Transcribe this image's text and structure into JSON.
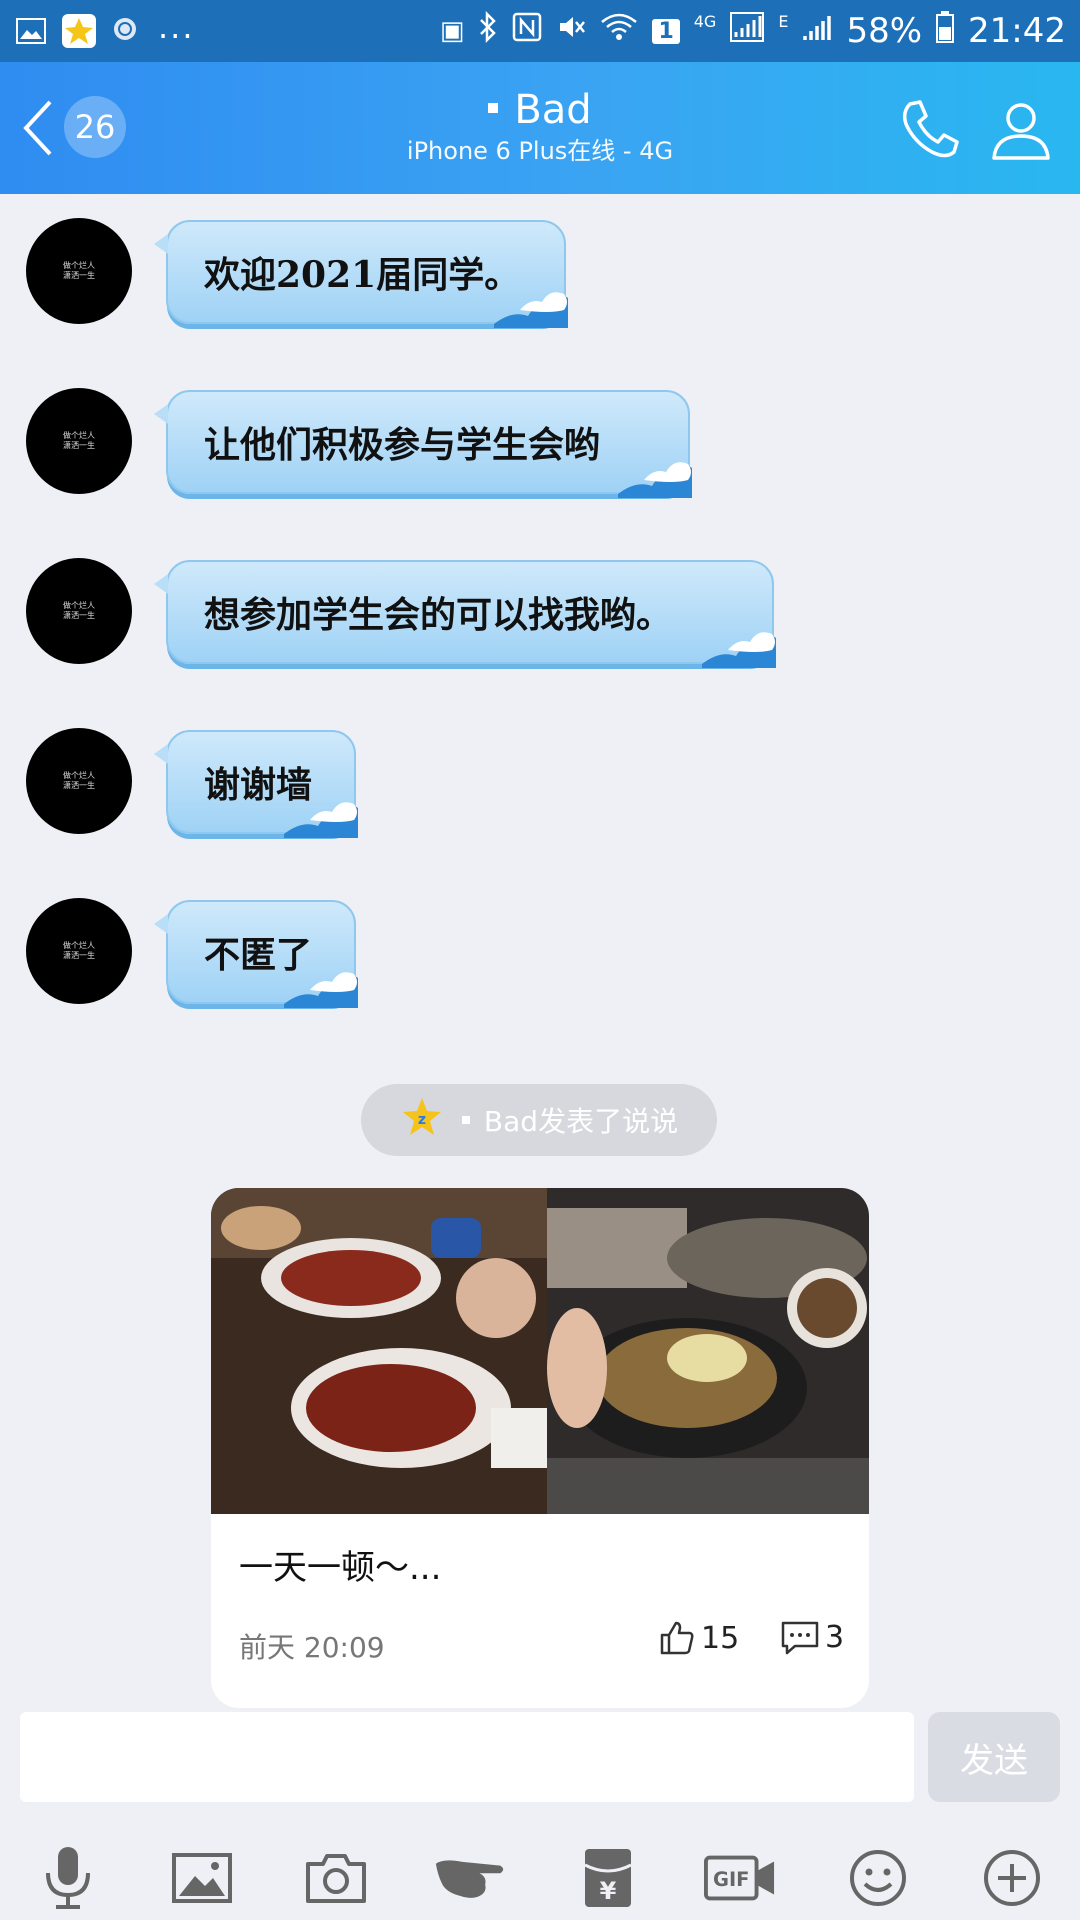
{
  "status_bar": {
    "battery": "58%",
    "time": "21:42",
    "network": "4G",
    "sim_badge": "1",
    "more": "...",
    "edge": "E"
  },
  "header": {
    "unread_count": "26",
    "contact_name": "Bad",
    "status": "iPhone 6 Plus在线 - 4G",
    "colors": {
      "start": "#2f8cf1",
      "end": "#29b7f0"
    }
  },
  "avatar_text": [
    "做个烂人",
    "潇洒一生"
  ],
  "messages": [
    {
      "text": "欢迎2021届同学。"
    },
    {
      "text": "让他们积极参与学生会哟"
    },
    {
      "text": "想参加学生会的可以找我哟。"
    },
    {
      "text": "谢谢墙"
    },
    {
      "text": "不匿了"
    }
  ],
  "notice": {
    "name": "Bad",
    "action": "发表了说说"
  },
  "card": {
    "text": "一天一顿～...",
    "time": "前天 20:09",
    "likes": "15",
    "comments": "3"
  },
  "input": {
    "value": "",
    "send_label": "发送"
  },
  "toolbar": {
    "icons": [
      "microphone-icon",
      "image-icon",
      "camera-icon",
      "poke-hand-icon",
      "red-packet-icon",
      "gif-icon",
      "emoji-icon",
      "plus-icon"
    ],
    "gif_label": "GIF",
    "currency_symbol": "¥"
  }
}
